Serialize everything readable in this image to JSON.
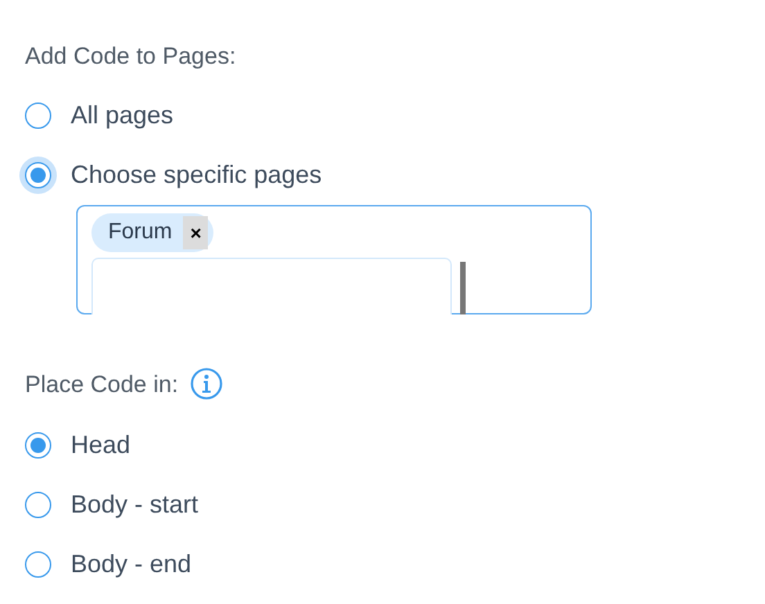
{
  "pages_section": {
    "title": "Add Code to Pages:",
    "options": [
      {
        "label": "All pages",
        "selected": false,
        "focused": false
      },
      {
        "label": "Choose specific pages",
        "selected": true,
        "focused": true
      }
    ],
    "page_picker": {
      "tags": [
        {
          "label": "Forum",
          "remove": "×"
        }
      ]
    }
  },
  "placement_section": {
    "title": "Place Code in:",
    "options": [
      {
        "label": "Head",
        "selected": true
      },
      {
        "label": "Body - start",
        "selected": false
      },
      {
        "label": "Body - end",
        "selected": false
      }
    ]
  }
}
